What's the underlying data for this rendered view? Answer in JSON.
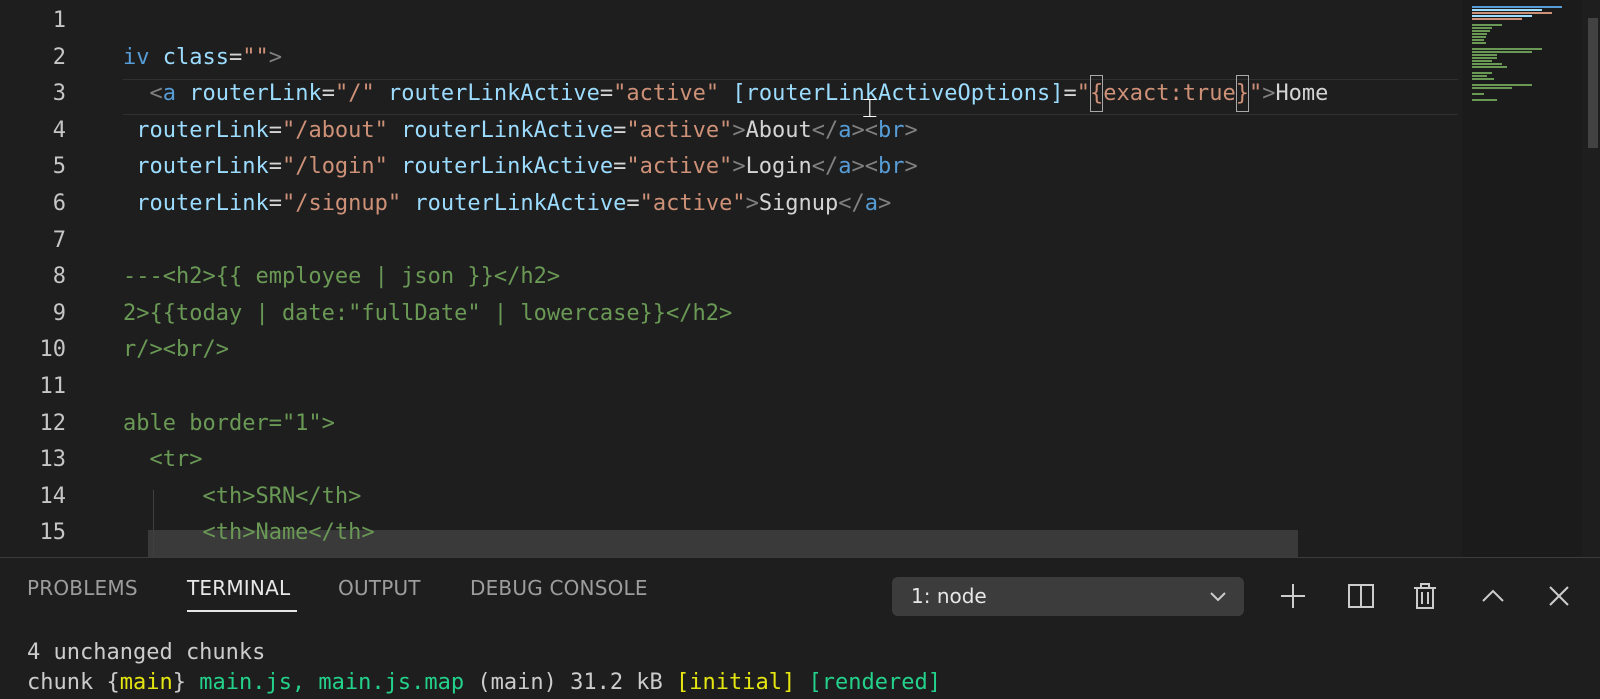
{
  "editor": {
    "line_numbers": [
      "1",
      "2",
      "3",
      "4",
      "5",
      "6",
      "7",
      "8",
      "9",
      "10",
      "11",
      "12",
      "13",
      "14",
      "15"
    ],
    "lines": [
      [],
      [
        {
          "t": "iv",
          "c": "name"
        },
        {
          "t": " ",
          "c": "txt"
        },
        {
          "t": "class",
          "c": "attr"
        },
        {
          "t": "=",
          "c": "eq"
        },
        {
          "t": "\"\"",
          "c": "str"
        },
        {
          "t": ">",
          "c": "tag"
        }
      ],
      [
        {
          "t": "  <",
          "c": "tag"
        },
        {
          "t": "a",
          "c": "name"
        },
        {
          "t": " ",
          "c": "txt"
        },
        {
          "t": "routerLink",
          "c": "attr"
        },
        {
          "t": "=",
          "c": "eq"
        },
        {
          "t": "\"/\"",
          "c": "str"
        },
        {
          "t": " ",
          "c": "txt"
        },
        {
          "t": "routerLinkActive",
          "c": "attr"
        },
        {
          "t": "=",
          "c": "eq"
        },
        {
          "t": "\"active\"",
          "c": "str"
        },
        {
          "t": " ",
          "c": "txt"
        },
        {
          "t": "[routerLinkActiveOptions]",
          "c": "attr"
        },
        {
          "t": "=",
          "c": "eq"
        },
        {
          "t": "\"",
          "c": "str"
        },
        {
          "t": "{",
          "c": "str",
          "box": true
        },
        {
          "t": "exact:true",
          "c": "str"
        },
        {
          "t": "}",
          "c": "str",
          "box": true
        },
        {
          "t": "\"",
          "c": "str"
        },
        {
          "t": ">",
          "c": "tag"
        },
        {
          "t": "Home",
          "c": "txt"
        }
      ],
      [
        {
          "t": " ",
          "c": "txt"
        },
        {
          "t": "routerLink",
          "c": "attr"
        },
        {
          "t": "=",
          "c": "eq"
        },
        {
          "t": "\"/about\"",
          "c": "str"
        },
        {
          "t": " ",
          "c": "txt"
        },
        {
          "t": "routerLinkActive",
          "c": "attr"
        },
        {
          "t": "=",
          "c": "eq"
        },
        {
          "t": "\"active\"",
          "c": "str"
        },
        {
          "t": ">",
          "c": "tag"
        },
        {
          "t": "About",
          "c": "txt"
        },
        {
          "t": "</",
          "c": "tag"
        },
        {
          "t": "a",
          "c": "name"
        },
        {
          "t": "><",
          "c": "tag"
        },
        {
          "t": "br",
          "c": "name"
        },
        {
          "t": ">",
          "c": "tag"
        }
      ],
      [
        {
          "t": " ",
          "c": "txt"
        },
        {
          "t": "routerLink",
          "c": "attr"
        },
        {
          "t": "=",
          "c": "eq"
        },
        {
          "t": "\"/login\"",
          "c": "str"
        },
        {
          "t": " ",
          "c": "txt"
        },
        {
          "t": "routerLinkActive",
          "c": "attr"
        },
        {
          "t": "=",
          "c": "eq"
        },
        {
          "t": "\"active\"",
          "c": "str"
        },
        {
          "t": ">",
          "c": "tag"
        },
        {
          "t": "Login",
          "c": "txt"
        },
        {
          "t": "</",
          "c": "tag"
        },
        {
          "t": "a",
          "c": "name"
        },
        {
          "t": "><",
          "c": "tag"
        },
        {
          "t": "br",
          "c": "name"
        },
        {
          "t": ">",
          "c": "tag"
        }
      ],
      [
        {
          "t": " ",
          "c": "txt"
        },
        {
          "t": "routerLink",
          "c": "attr"
        },
        {
          "t": "=",
          "c": "eq"
        },
        {
          "t": "\"/signup\"",
          "c": "str"
        },
        {
          "t": " ",
          "c": "txt"
        },
        {
          "t": "routerLinkActive",
          "c": "attr"
        },
        {
          "t": "=",
          "c": "eq"
        },
        {
          "t": "\"active\"",
          "c": "str"
        },
        {
          "t": ">",
          "c": "tag"
        },
        {
          "t": "Signup",
          "c": "txt"
        },
        {
          "t": "</",
          "c": "tag"
        },
        {
          "t": "a",
          "c": "name"
        },
        {
          "t": ">",
          "c": "tag"
        }
      ],
      [],
      [
        {
          "t": "---<h2>{{ employee | json }}</h2>",
          "c": "cmt"
        }
      ],
      [
        {
          "t": "2>{{today | date:\"fullDate\" | lowercase}}</h2>",
          "c": "cmt"
        }
      ],
      [
        {
          "t": "r/><br/>",
          "c": "cmt"
        }
      ],
      [],
      [
        {
          "t": "able border=\"1\">",
          "c": "cmt"
        }
      ],
      [
        {
          "t": "  <tr>",
          "c": "cmt"
        }
      ],
      [
        {
          "t": "      <th>SRN</th>",
          "c": "cmt"
        }
      ],
      [
        {
          "t": "      <th>Name</th>",
          "c": "cmt"
        }
      ]
    ]
  },
  "panel": {
    "tabs": [
      {
        "label": "PROBLEMS",
        "active": false
      },
      {
        "label": "TERMINAL",
        "active": true
      },
      {
        "label": "OUTPUT",
        "active": false
      },
      {
        "label": "DEBUG CONSOLE",
        "active": false
      }
    ],
    "terminal_select": {
      "value": "1: node"
    },
    "icons": [
      "plus-icon",
      "split-icon",
      "trash-icon",
      "chevron-up-icon",
      "close-icon"
    ],
    "terminal_lines": [
      [
        {
          "t": "4 unchanged chunks",
          "c": "white"
        }
      ],
      [
        {
          "t": "chunk ",
          "c": "white"
        },
        {
          "t": "{",
          "c": "white"
        },
        {
          "t": "main",
          "c": "yellow"
        },
        {
          "t": "}",
          "c": "white"
        },
        {
          "t": " ",
          "c": "white"
        },
        {
          "t": "main.js, main.js.map",
          "c": "green"
        },
        {
          "t": " (main) 31.2 kB ",
          "c": "white"
        },
        {
          "t": "[initial]",
          "c": "yellow"
        },
        {
          "t": " ",
          "c": "white"
        },
        {
          "t": "[rendered]",
          "c": "green"
        }
      ]
    ]
  },
  "colors": {
    "background": "#1e1e1e",
    "tag": "#808080",
    "tag_name": "#569cd6",
    "attribute": "#9cdcfe",
    "string": "#ce9178",
    "comment": "#6a9955",
    "text": "#d4d4d4"
  }
}
